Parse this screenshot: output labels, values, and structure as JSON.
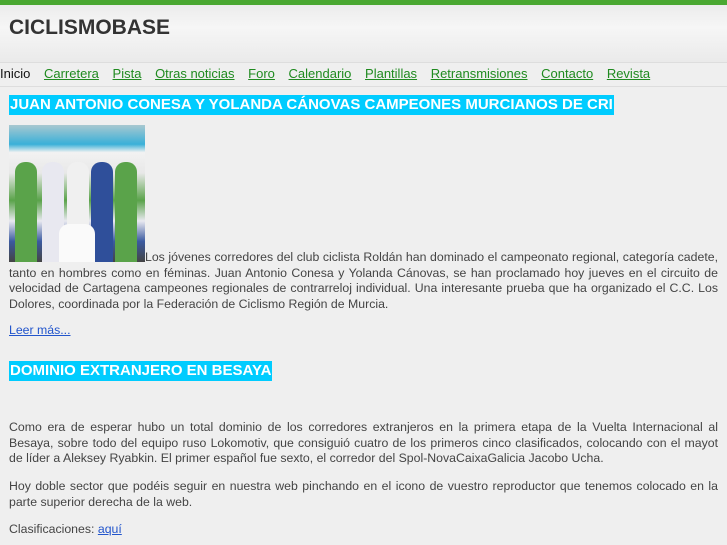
{
  "site": {
    "title": "CICLISMOBASE"
  },
  "nav": {
    "active": "Inicio",
    "items": [
      "Carretera",
      "Pista",
      "Otras noticias",
      "Foro",
      "Calendario",
      "Plantillas",
      "Retransmisiones",
      "Contacto",
      "Revista"
    ]
  },
  "articles": [
    {
      "title": "JUAN ANTONIO CONESA Y YOLANDA CÁNOVAS CAMPEONES MURCIANOS DE CRI",
      "body": "Los jóvenes corredores del club ciclista Roldán han dominado el campeonato regional, categoría cadete, tanto en hombres como en féminas. Juan Antonio Conesa y Yolanda Cánovas,  se han proclamado hoy jueves en el circuito de velocidad de Cartagena campeones regionales de contrarreloj individual. Una interesante prueba que ha organizado el C.C. Los Dolores, coordinada por la Federación de Ciclismo Región de Murcia.",
      "read_more": "Leer más..."
    },
    {
      "title": "DOMINIO EXTRANJERO EN BESAYA",
      "p1": "Como era de esperar hubo un total dominio de los corredores extranjeros en la primera etapa de la Vuelta Internacional al Besaya, sobre todo del equipo ruso Lokomotiv, que consiguió cuatro de los primeros cinco clasificados, colocando con el mayot de líder a Aleksey Ryabkin. El primer español fue sexto, el corredor del Spol-NovaCaixaGalicia Jacobo Ucha.",
      "p2": "Hoy doble sector que podéis seguir en nuestra web pinchando en el icono de vuestro reproductor que tenemos colocado en la parte superior derecha de la web.",
      "p3_label": "Clasificaciones:",
      "p3_link": "aquí"
    }
  ]
}
